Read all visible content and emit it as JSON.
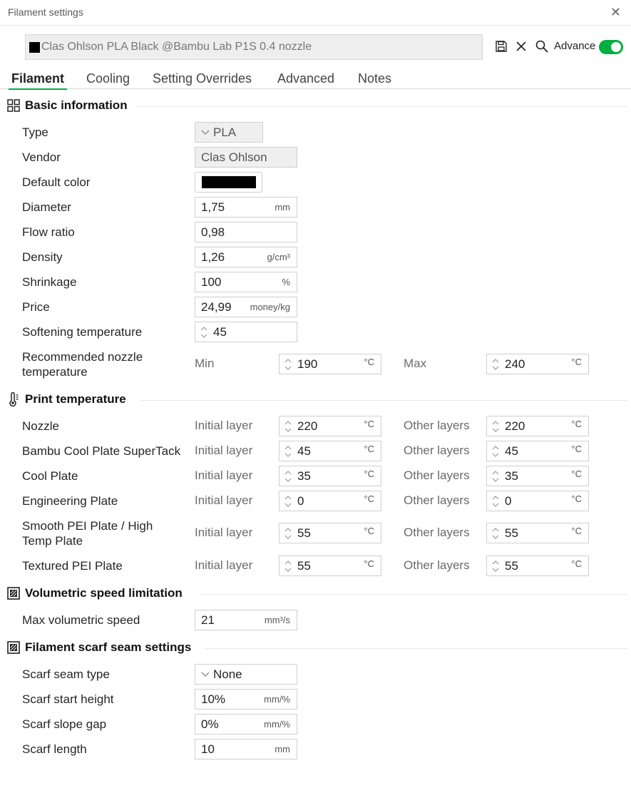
{
  "window": {
    "title": "Filament settings"
  },
  "preset": {
    "name": "Clas Ohlson PLA Black @Bambu Lab P1S 0.4 nozzle",
    "swatch_color": "#000000"
  },
  "toolbar": {
    "advance_label": "Advance",
    "advance_on": true,
    "icons": [
      "save-icon",
      "close-icon",
      "search-icon"
    ]
  },
  "tabs": [
    "Filament",
    "Cooling",
    "Setting Overrides",
    "Advanced",
    "Notes"
  ],
  "sections": {
    "basic": {
      "title": "Basic information",
      "type": {
        "label": "Type",
        "value": "PLA"
      },
      "vendor": {
        "label": "Vendor",
        "value": "Clas Ohlson"
      },
      "default_color": {
        "label": "Default color",
        "value": "#000000"
      },
      "diameter": {
        "label": "Diameter",
        "value": "1,75",
        "unit": "mm"
      },
      "flow_ratio": {
        "label": "Flow ratio",
        "value": "0,98"
      },
      "density": {
        "label": "Density",
        "value": "1,26",
        "unit": "g/cm³"
      },
      "shrinkage": {
        "label": "Shrinkage",
        "value": "100",
        "unit": "%"
      },
      "price": {
        "label": "Price",
        "value": "24,99",
        "unit": "money/kg"
      },
      "softening": {
        "label": "Softening temperature",
        "value": "45"
      },
      "nozzle_temp": {
        "label1": "Recommended nozzle",
        "label2": "temperature",
        "min_label": "Min",
        "min": "190",
        "max_label": "Max",
        "max": "240",
        "unit": "°C"
      }
    },
    "print_temp": {
      "title": "Print temperature",
      "initial_label": "Initial layer",
      "other_label": "Other layers",
      "unit": "°C",
      "rows": [
        {
          "label1": "Nozzle",
          "label2": "",
          "initial": "220",
          "other": "220"
        },
        {
          "label1": "Bambu Cool Plate SuperTack",
          "label2": "",
          "initial": "45",
          "other": "45"
        },
        {
          "label1": "Cool Plate",
          "label2": "",
          "initial": "35",
          "other": "35"
        },
        {
          "label1": "Engineering Plate",
          "label2": "",
          "initial": "0",
          "other": "0"
        },
        {
          "label1": "Smooth PEI Plate / High",
          "label2": "Temp Plate",
          "initial": "55",
          "other": "55"
        },
        {
          "label1": "Textured PEI Plate",
          "label2": "",
          "initial": "55",
          "other": "55"
        }
      ]
    },
    "volumetric": {
      "title": "Volumetric speed limitation",
      "max_speed": {
        "label": "Max volumetric speed",
        "value": "21",
        "unit": "mm³/s"
      }
    },
    "scarf": {
      "title": "Filament scarf seam settings",
      "type": {
        "label": "Scarf seam type",
        "value": "None"
      },
      "start_height": {
        "label": "Scarf start height",
        "value": "10%",
        "unit": "mm/%"
      },
      "slope_gap": {
        "label": "Scarf slope gap",
        "value": "0%",
        "unit": "mm/%"
      },
      "length": {
        "label": "Scarf length",
        "value": "10",
        "unit": "mm"
      }
    }
  },
  "colors": {
    "accent": "#00ae42"
  }
}
